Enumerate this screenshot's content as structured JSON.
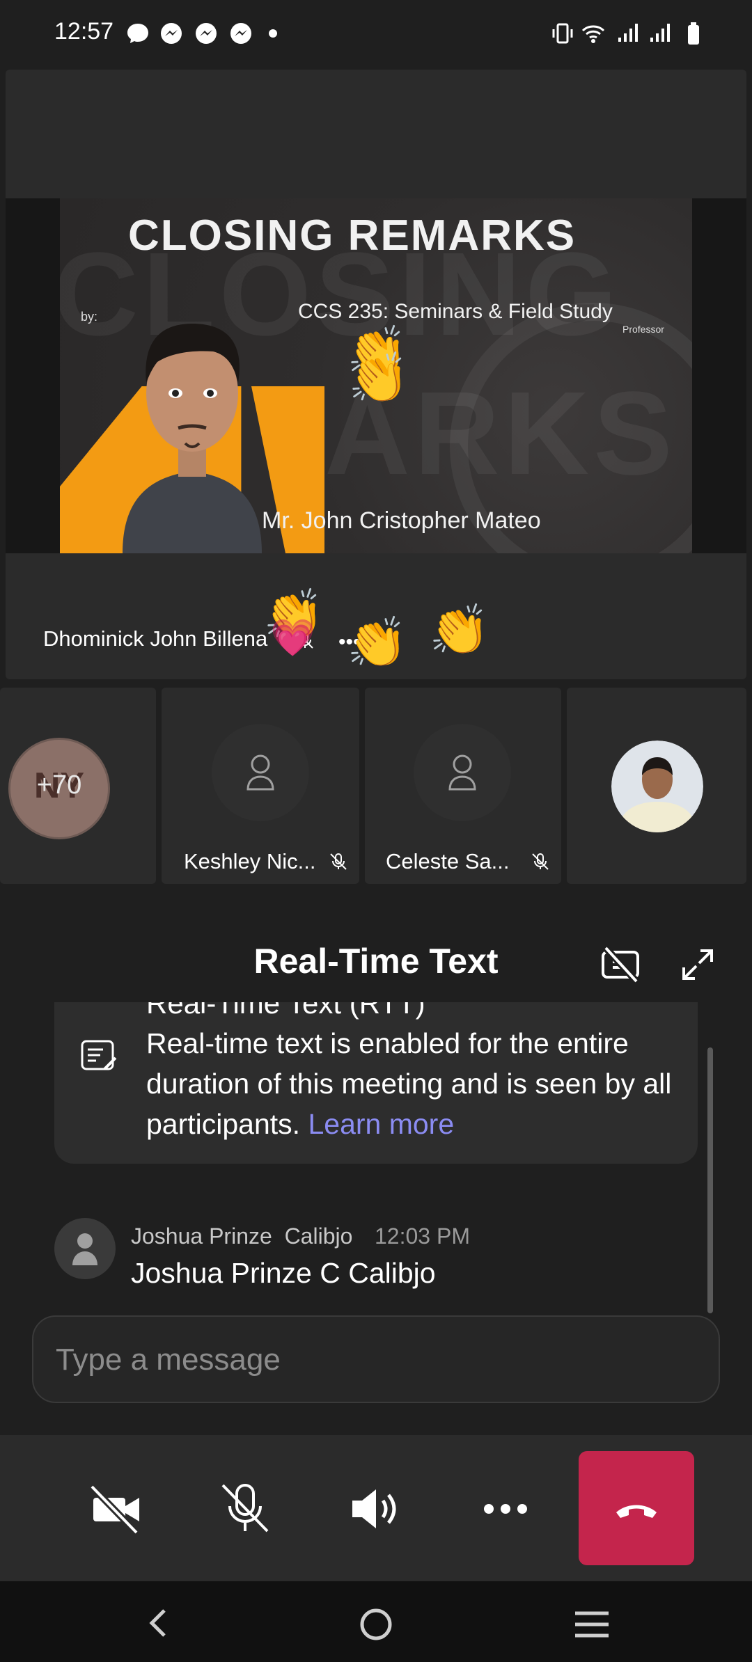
{
  "status_bar": {
    "time": "12:57",
    "icons": [
      "chat-bubble-icon",
      "messenger-icon",
      "messenger-icon",
      "messenger-icon",
      "dot-icon",
      "vibrate-icon",
      "wifi-icon",
      "signal-icon",
      "signal-icon",
      "battery-icon"
    ]
  },
  "stage": {
    "slide": {
      "title": "CLOSING REMARKS",
      "course": "CCS 235: Seminars & Field Study",
      "role": "Professor",
      "by": "by:",
      "speaker": "Mr. John Cristopher Mateo",
      "watermark_1": "CLOSING",
      "watermark_2": "ARKS"
    },
    "presenter_name": "Dhominick John Billena",
    "more_indicator": "•••",
    "reactions": [
      "👏",
      "👏",
      "👏",
      "👏",
      "👏",
      "💗"
    ]
  },
  "participants": {
    "overflow_count": "+70",
    "overflow_initials": "NY",
    "tiles": [
      {
        "name": "Keshley Nic..."
      },
      {
        "name": "Celeste Sa..."
      }
    ]
  },
  "rtt": {
    "title": "Real-Time Text",
    "notice_heading": "Real-Time Text (RTT)",
    "notice_text": "Real-time text is enabled for the entire duration of this meeting and is seen by all participants.",
    "notice_link": "Learn more",
    "message": {
      "sender": "Joshua Prinze  Calibjo",
      "time": "12:03 PM",
      "text": "Joshua Prinze C Calibjo"
    },
    "input_placeholder": "Type a message"
  },
  "controls": {
    "camera": "camera-off-icon",
    "mic": "mic-off-icon",
    "speaker": "speaker-icon",
    "more": "more-icon",
    "hangup": "hang-up-icon",
    "hangup_color": "#c4254c"
  },
  "navbar": [
    "back-icon",
    "home-icon",
    "recents-icon"
  ]
}
